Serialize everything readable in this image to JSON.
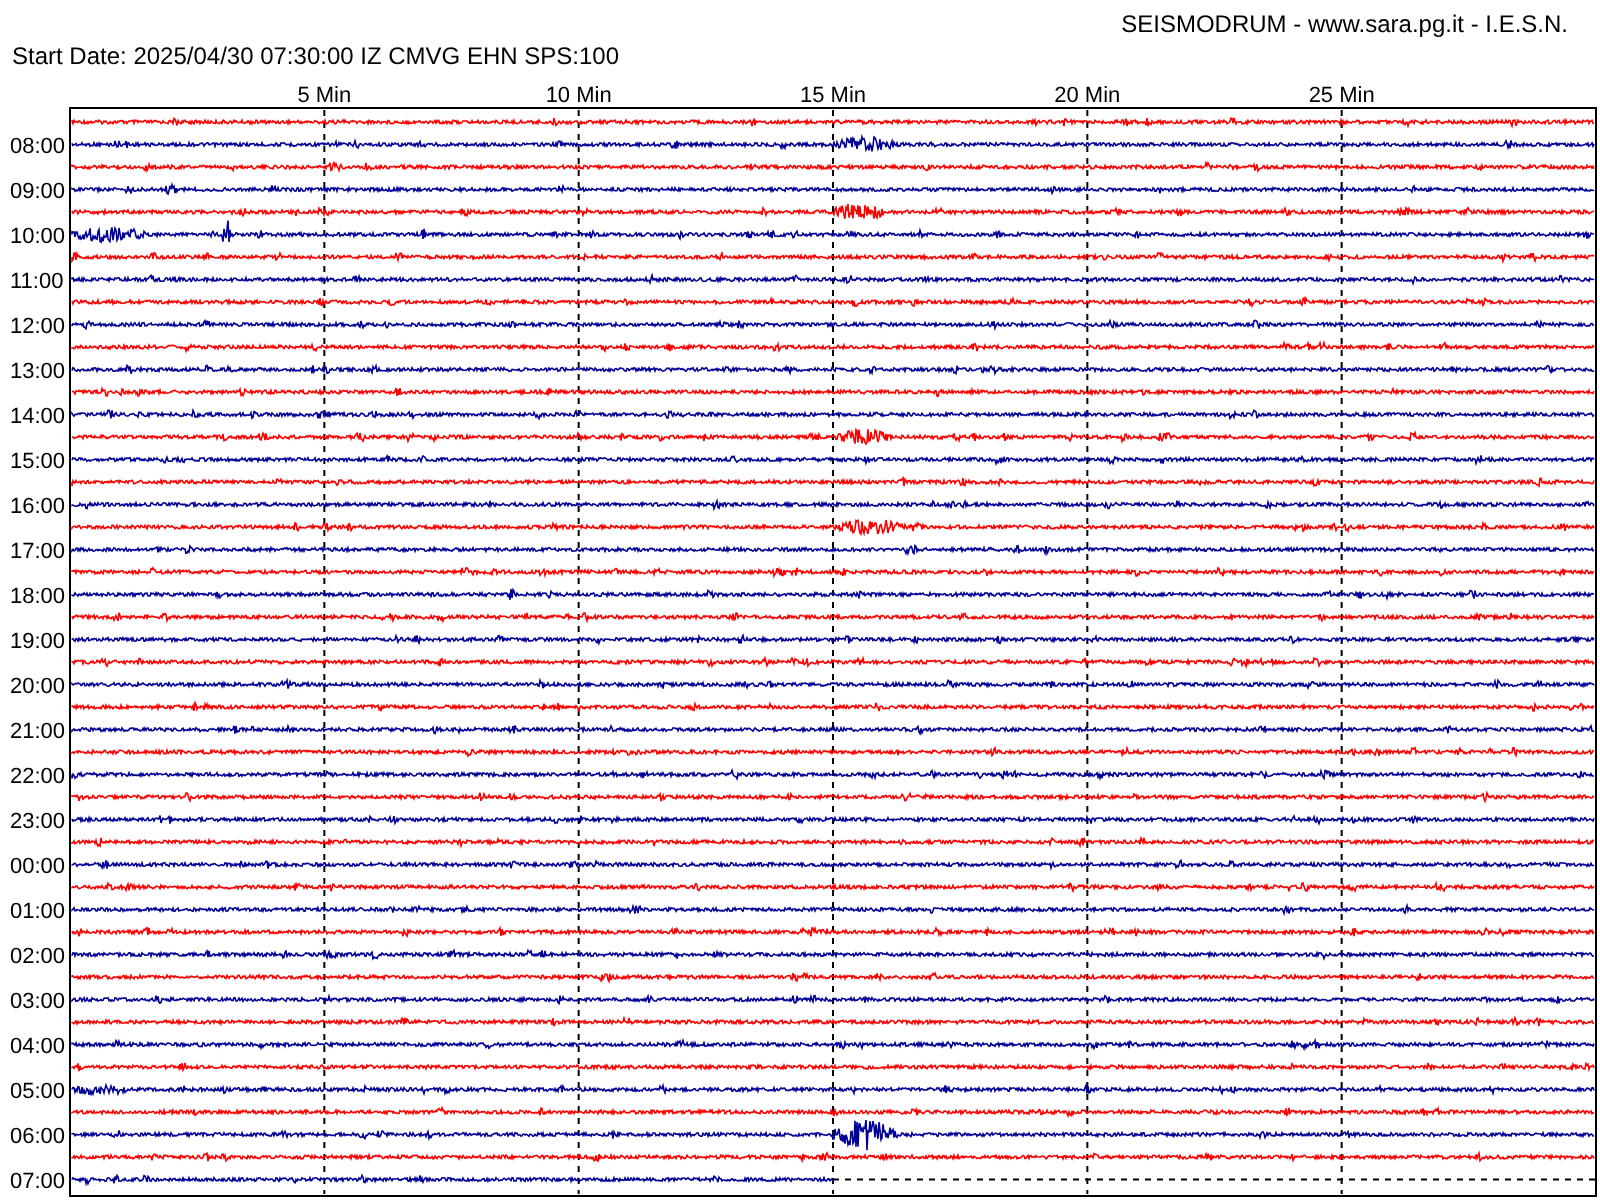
{
  "title": "SEISMODRUM - www.sara.pg.it - I.E.S.N.",
  "start_date": "Start Date: 2025/04/30 07:30:00 IZ CMVG EHN SPS:100",
  "minute_labels": [
    "5 Min",
    "10 Min",
    "15 Min",
    "20 Min",
    "25 Min"
  ],
  "hour_labels": [
    "08:00",
    "09:00",
    "10:00",
    "11:00",
    "12:00",
    "13:00",
    "14:00",
    "15:00",
    "16:00",
    "17:00",
    "18:00",
    "19:00",
    "20:00",
    "21:00",
    "22:00",
    "23:00",
    "00:00",
    "01:00",
    "02:00",
    "03:00",
    "04:00",
    "05:00",
    "06:00",
    "07:00"
  ]
}
